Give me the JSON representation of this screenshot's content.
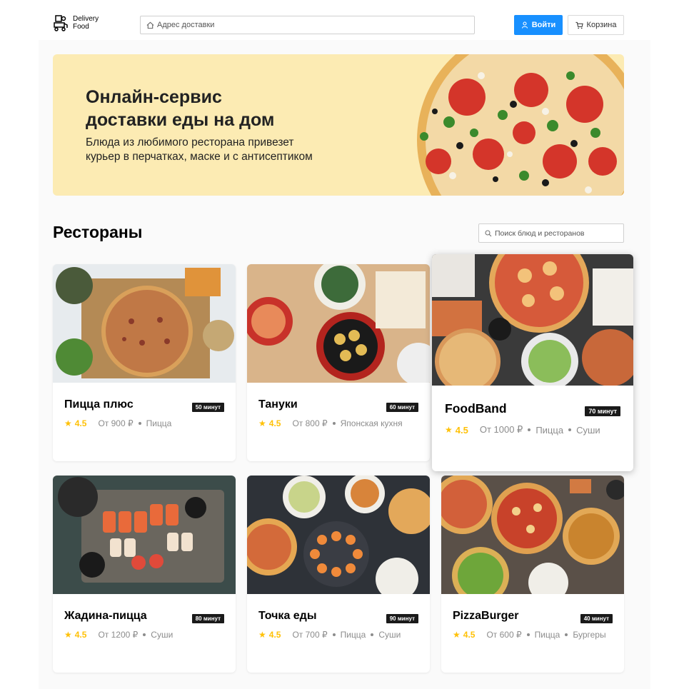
{
  "header": {
    "logo_line1": "Delivery",
    "logo_line2": "Food",
    "address_placeholder": "Адрес доставки",
    "login_label": "Войти",
    "cart_label": "Корзина"
  },
  "promo": {
    "title_line1": "Онлайн-сервис",
    "title_line2": "доставки еды на дом",
    "text_line1": "Блюда из любимого ресторана привезет",
    "text_line2": "курьер в перчатках, маске и с антисептиком"
  },
  "section": {
    "title": "Рестораны",
    "search_placeholder": "Поиск блюд и ресторанов"
  },
  "restaurants": [
    {
      "name": "Пицца плюс",
      "time": "50 минут",
      "rating": "4.5",
      "price": "От 900 ₽",
      "tags": [
        "Пицца"
      ]
    },
    {
      "name": "Тануки",
      "time": "60 минут",
      "rating": "4.5",
      "price": "От 800 ₽",
      "tags": [
        "Японская кухня"
      ]
    },
    {
      "name": "FoodBand",
      "time": "70 минут",
      "rating": "4.5",
      "price": "От 1000 ₽",
      "tags": [
        "Пицца",
        "Суши"
      ]
    },
    {
      "name": "Жадина-пицца",
      "time": "80 минут",
      "rating": "4.5",
      "price": "От 1200 ₽",
      "tags": [
        "Суши"
      ]
    },
    {
      "name": "Точка еды",
      "time": "90 минут",
      "rating": "4.5",
      "price": "От 700 ₽",
      "tags": [
        "Пицца",
        "Суши"
      ]
    },
    {
      "name": "PizzaBurger",
      "time": "40 минут",
      "rating": "4.5",
      "price": "От 600 ₽",
      "tags": [
        "Пицца",
        "Бургеры"
      ]
    }
  ],
  "colors": {
    "accent": "#1890ff",
    "promo_bg": "#fcebb3",
    "star": "#ffc107"
  }
}
